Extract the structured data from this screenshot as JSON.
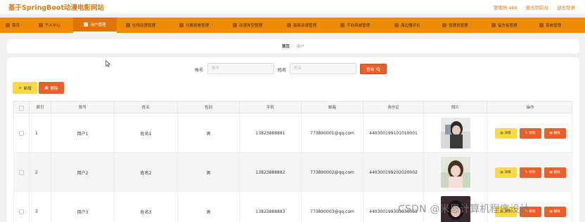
{
  "site_title": "基于SpringBoot动漫电影网站",
  "top_links": [
    "管理员 abo",
    "退出到前台",
    "退出登录"
  ],
  "nav": [
    {
      "label": "首页",
      "icon": "home-icon",
      "active": false
    },
    {
      "label": "个人中心",
      "icon": "user-icon",
      "active": false
    },
    {
      "label": "用户管理",
      "icon": "users-icon",
      "active": true
    },
    {
      "label": "在线动漫管理",
      "icon": "video-icon",
      "active": false
    },
    {
      "label": "付费观看管理",
      "icon": "pay-icon",
      "active": false
    },
    {
      "label": "动漫类型管理",
      "icon": "tag-icon",
      "active": false
    },
    {
      "label": "最新动漫管理",
      "icon": "new-icon",
      "active": false
    },
    {
      "label": "手办商城管理",
      "icon": "shop-icon",
      "active": false
    },
    {
      "label": "周边播评论",
      "icon": "comment-icon",
      "active": false
    },
    {
      "label": "管理员管理",
      "icon": "admin-icon",
      "active": false
    },
    {
      "label": "留言板管理",
      "icon": "message-icon",
      "active": false
    },
    {
      "label": "系统管理",
      "icon": "settings-icon",
      "active": false
    }
  ],
  "breadcrumb": {
    "home": "首页",
    "separator": "/",
    "current": "用户"
  },
  "search": {
    "account_label": "账号",
    "account_placeholder": "账号",
    "account_value": "",
    "name_label": "姓名",
    "name_placeholder": "姓名",
    "name_value": "",
    "button_label": "查询"
  },
  "actions": {
    "add_label": "新增",
    "delete_label": "删除"
  },
  "table": {
    "headers": [
      "索引",
      "账号",
      "姓名",
      "性别",
      "手机",
      "邮箱",
      "身份证",
      "照片",
      "操作"
    ],
    "rows": [
      {
        "index": "1",
        "account": "用户1",
        "name": "姓名1",
        "gender": "男",
        "phone": "13823888881",
        "email": "773890001@qq.com",
        "id_card": "440300199101010001"
      },
      {
        "index": "2",
        "account": "用户2",
        "name": "姓名2",
        "gender": "男",
        "phone": "13823888882",
        "email": "773890002@qq.com",
        "id_card": "440300199202020002"
      },
      {
        "index": "3",
        "account": "用户3",
        "name": "姓名3",
        "gender": "男",
        "phone": "13823888883",
        "email": "773890003@qq.com",
        "id_card": "440300199303030003"
      }
    ],
    "op_detail": "详情",
    "op_edit": "修改",
    "op_delete": "删除"
  },
  "watermark": "CSDN @米恩计算机程序设计",
  "colors": {
    "accent": "#f08a00",
    "danger": "#e8612c",
    "warning": "#f8d94a"
  }
}
